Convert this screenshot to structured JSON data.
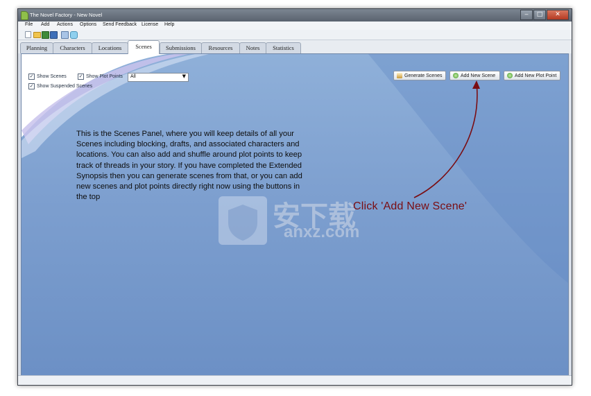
{
  "window": {
    "title": "The Novel Factory - New Novel",
    "controls": {
      "minimize": "‒",
      "maximize": "□",
      "close": "✕"
    }
  },
  "menu": [
    "File",
    "Add",
    "Actions",
    "Options",
    "Send Feedback",
    "License",
    "Help"
  ],
  "toolbar": {
    "icons": [
      "new-file-icon",
      "open-folder-icon",
      "save-icon",
      "save-all-icon",
      "print-icon",
      "comment-icon"
    ]
  },
  "tabs": [
    "Planning",
    "Characters",
    "Locations",
    "Scenes",
    "Submissions",
    "Resources",
    "Notes",
    "Statistics"
  ],
  "active_tab": "Scenes",
  "filters": {
    "show_scenes": {
      "label": "Show Scenes",
      "checked": true
    },
    "show_plot_points": {
      "label": "Show Plot Points",
      "checked": true
    },
    "show_suspended": {
      "label": "Show Suspended Scenes",
      "checked": true
    },
    "dropdown_value": "All"
  },
  "buttons": {
    "generate_scenes": "Generate Scenes",
    "add_new_scene": "Add New Scene",
    "add_new_plot_point": "Add New Plot Point"
  },
  "help_text": "This is the Scenes Panel, where you will keep details of all your Scenes including blocking, drafts, and associated characters and locations. You can also add and shuffle around plot points to keep track of threads in your story. If you have completed the Extended Synopsis then you can generate scenes from that, or you can add new scenes and plot points directly right now using the buttons in the top",
  "annotation": {
    "text": "Click 'Add New Scene'"
  },
  "watermark": {
    "text": "安下载",
    "subtext": "anxz.com"
  },
  "colors": {
    "panel_blue": "#7d9fcf",
    "annotation_red": "#7a0d12",
    "add_icon_green": "#3d9a2a"
  }
}
